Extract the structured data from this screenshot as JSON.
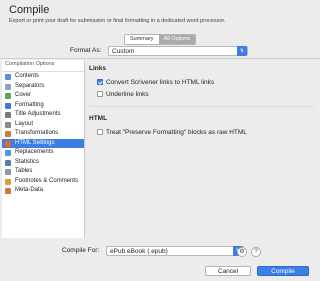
{
  "window": {
    "title": "Compile",
    "subtitle": "Export or print your draft for submission or final formatting in a dedicated word processor."
  },
  "tabs": [
    {
      "label": "Summary",
      "active": false
    },
    {
      "label": "All Options",
      "active": true
    }
  ],
  "format": {
    "label": "Format As:",
    "value": "Custom"
  },
  "sidebar": {
    "header": "Compilation Options",
    "items": [
      {
        "label": "Contents",
        "icon": "contents-icon",
        "color": "#5a8fd6",
        "selected": false
      },
      {
        "label": "Separators",
        "icon": "separators-icon",
        "color": "#8aa3c2",
        "selected": false
      },
      {
        "label": "Cover",
        "icon": "cover-icon",
        "color": "#5aa65a",
        "selected": false
      },
      {
        "label": "Formatting",
        "icon": "formatting-icon",
        "color": "#3c78d8",
        "selected": false
      },
      {
        "label": "Title Adjustments",
        "icon": "title-adjustments-icon",
        "color": "#7a7a7a",
        "selected": false
      },
      {
        "label": "Layout",
        "icon": "layout-icon",
        "color": "#8a8a8a",
        "selected": false
      },
      {
        "label": "Transformations",
        "icon": "transformations-icon",
        "color": "#c08040",
        "selected": false
      },
      {
        "label": "HTML Settings",
        "icon": "html-settings-icon",
        "color": "#e06a2a",
        "selected": true
      },
      {
        "label": "Replacements",
        "icon": "replacements-icon",
        "color": "#4a9ad4",
        "selected": false
      },
      {
        "label": "Statistics",
        "icon": "statistics-icon",
        "color": "#5a7ab0",
        "selected": false
      },
      {
        "label": "Tables",
        "icon": "tables-icon",
        "color": "#8a9aaa",
        "selected": false
      },
      {
        "label": "Footnotes & Comments",
        "icon": "footnotes-icon",
        "color": "#d4a030",
        "selected": false
      },
      {
        "label": "Meta-Data",
        "icon": "meta-data-icon",
        "color": "#c87a4a",
        "selected": false
      }
    ]
  },
  "links_section": {
    "title": "Links",
    "options": [
      {
        "label": "Convert Scrivener links to HTML links",
        "checked": true
      },
      {
        "label": "Underline links",
        "checked": false
      }
    ]
  },
  "html_section": {
    "title": "HTML",
    "options": [
      {
        "label": "Treat \"Preserve Formatting\" blocks as raw HTML",
        "checked": false
      }
    ]
  },
  "footer": {
    "compile_for_label": "Compile For:",
    "compile_for_value": "ePub eBook (.epub)",
    "cancel_label": "Cancel",
    "compile_label": "Compile",
    "accent": "#3b7ee6"
  }
}
